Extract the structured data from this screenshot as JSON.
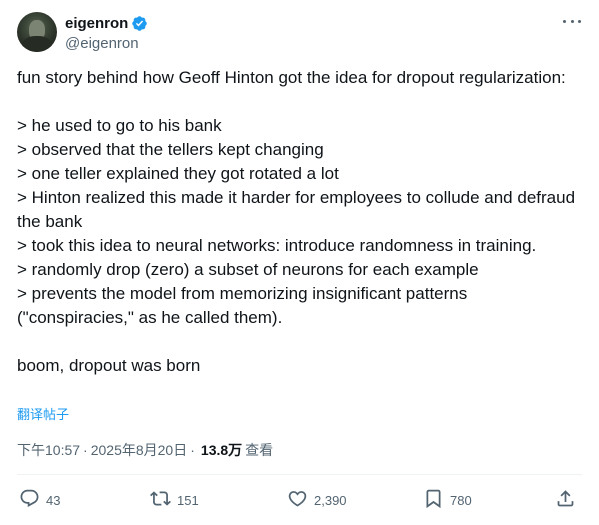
{
  "author": {
    "display_name": "eigenron",
    "handle": "@eigenron",
    "verified": true
  },
  "tweet": {
    "lines": [
      "fun story behind how Geoff Hinton got the idea for dropout regularization:",
      "",
      "> he used to go to his bank",
      "> observed that the tellers kept changing",
      "> one teller explained they got rotated a lot",
      "> Hinton realized this made it harder for employees to collude and defraud the bank",
      "> took this idea to neural networks: introduce randomness in training.",
      "> randomly drop (zero) a subset of neurons for each example",
      "> prevents the model from memorizing insignificant patterns (\"conspiracies,\" as he called them).",
      "",
      "boom, dropout was born"
    ]
  },
  "translate_label": "翻译帖子",
  "meta": {
    "time": "下午10:57",
    "separator": "·",
    "date": "2025年8月20日",
    "views_count": "13.8万",
    "views_label": "查看"
  },
  "actions": {
    "replies": "43",
    "retweets": "151",
    "likes": "2,390",
    "bookmarks": "780"
  },
  "colors": {
    "text": "#0f1419",
    "secondary": "#536471",
    "accent": "#1d9bf0"
  },
  "icons": [
    "verified-badge-icon",
    "more-icon",
    "reply-icon",
    "retweet-icon",
    "like-icon",
    "bookmark-icon",
    "share-icon"
  ]
}
